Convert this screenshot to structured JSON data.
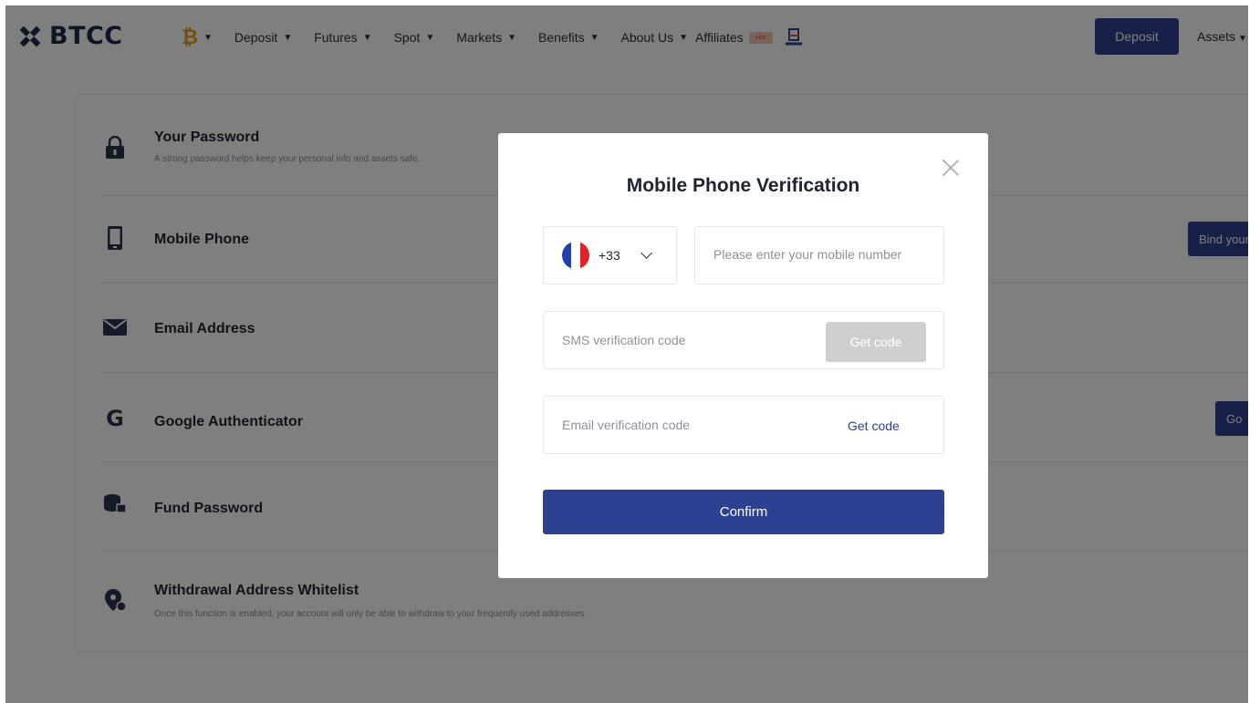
{
  "header": {
    "brand": "BTCC",
    "nav": [
      {
        "label": "Deposit"
      },
      {
        "label": "Futures"
      },
      {
        "label": "Spot"
      },
      {
        "label": "Markets"
      },
      {
        "label": "Benefits"
      },
      {
        "label": "About Us"
      }
    ],
    "affiliates_label": "Affiliates",
    "hot_badge": "Hot",
    "deposit_button": "Deposit",
    "assets_label": "Assets"
  },
  "security": {
    "rows": [
      {
        "title": "Your Password",
        "desc": "A strong password helps keep your personal info and assets safe."
      },
      {
        "title": "Mobile Phone",
        "action": "Bind your mobile"
      },
      {
        "title": "Email Address"
      },
      {
        "title": "Google Authenticator",
        "action": "Go"
      },
      {
        "title": "Fund Password"
      },
      {
        "title": "Withdrawal Address Whitelist",
        "desc": "Once this function is enabled, your account will only be able to withdraw to your frequently used addresses."
      }
    ]
  },
  "modal": {
    "title": "Mobile Phone Verification",
    "country_code": "+33",
    "phone_placeholder": "Please enter your mobile number",
    "sms_placeholder": "SMS verification code",
    "sms_get_code": "Get code",
    "email_placeholder": "Email verification code",
    "email_get_code": "Get code",
    "confirm": "Confirm"
  },
  "colors": {
    "primary": "#2c4191",
    "overlay": "rgba(0,0,0,0.5)",
    "disabled": "#cfcfcf"
  }
}
